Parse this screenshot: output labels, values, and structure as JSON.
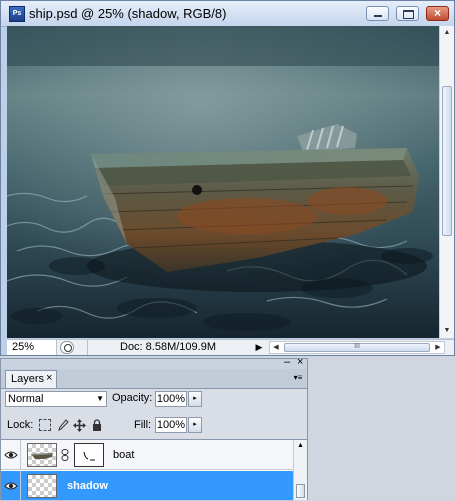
{
  "window": {
    "title": "ship.psd @ 25% (shadow, RGB/8)",
    "app_icon_text": "Ps",
    "controls": {
      "minimize": "minimize",
      "maximize": "maximize",
      "close": "×"
    }
  },
  "canvas": {
    "description_icon": "image-canvas"
  },
  "status": {
    "zoom": "25%",
    "doc_info": "Doc: 8.58M/109.9M",
    "arrow": "▶",
    "hscroll_grip": "III",
    "left_arrow": "◀",
    "right_arrow": "▶"
  },
  "layers_panel": {
    "tab_label": "Layers",
    "tab_close": "×",
    "panel_minimize": "–",
    "panel_close": "×",
    "menu_icon": "▾≡",
    "blend_mode": "Normal",
    "opacity_label": "Opacity:",
    "opacity_value": "100%",
    "lock_label": "Lock:",
    "fill_label": "Fill:",
    "fill_value": "100%",
    "stepper_glyph": "▸",
    "layers": [
      {
        "name": "boat",
        "visible": true,
        "selected": false,
        "has_mask": true
      },
      {
        "name": "shadow",
        "visible": true,
        "selected": true,
        "has_mask": false
      }
    ]
  },
  "colors": {
    "selection": "#3399ff",
    "titlebar": "#c4d5ec",
    "close_button": "#c24b31"
  }
}
